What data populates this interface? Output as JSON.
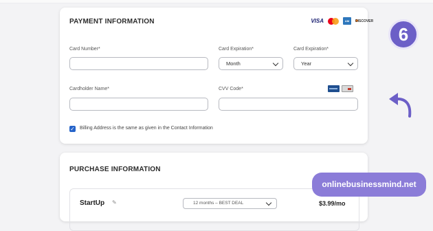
{
  "payment": {
    "title": "PAYMENT INFORMATION",
    "card_logos": {
      "visa": "VISA",
      "discover": "DISCOVER"
    },
    "card_number_label": "Card Number*",
    "card_number_value": "",
    "exp_month_label": "Card Expiration*",
    "exp_month_value": "Month",
    "exp_year_label": "Card Expiration*",
    "exp_year_value": "Year",
    "cardholder_label": "Cardholder Name*",
    "cardholder_value": "",
    "cvv_label": "CVV Code*",
    "cvv_value": "",
    "billing_same_checked": true,
    "billing_same_label": "Billing Address is the same as given in the Contact Information"
  },
  "purchase": {
    "title": "PURCHASE INFORMATION",
    "plan_name": "StartUp",
    "plan_term": "12 months – BEST DEAL",
    "plan_price": "$3.99/mo"
  },
  "overlay": {
    "step_number": "6",
    "watermark": "onlinebusinessmind.net",
    "accent": "#6c5fc7"
  }
}
